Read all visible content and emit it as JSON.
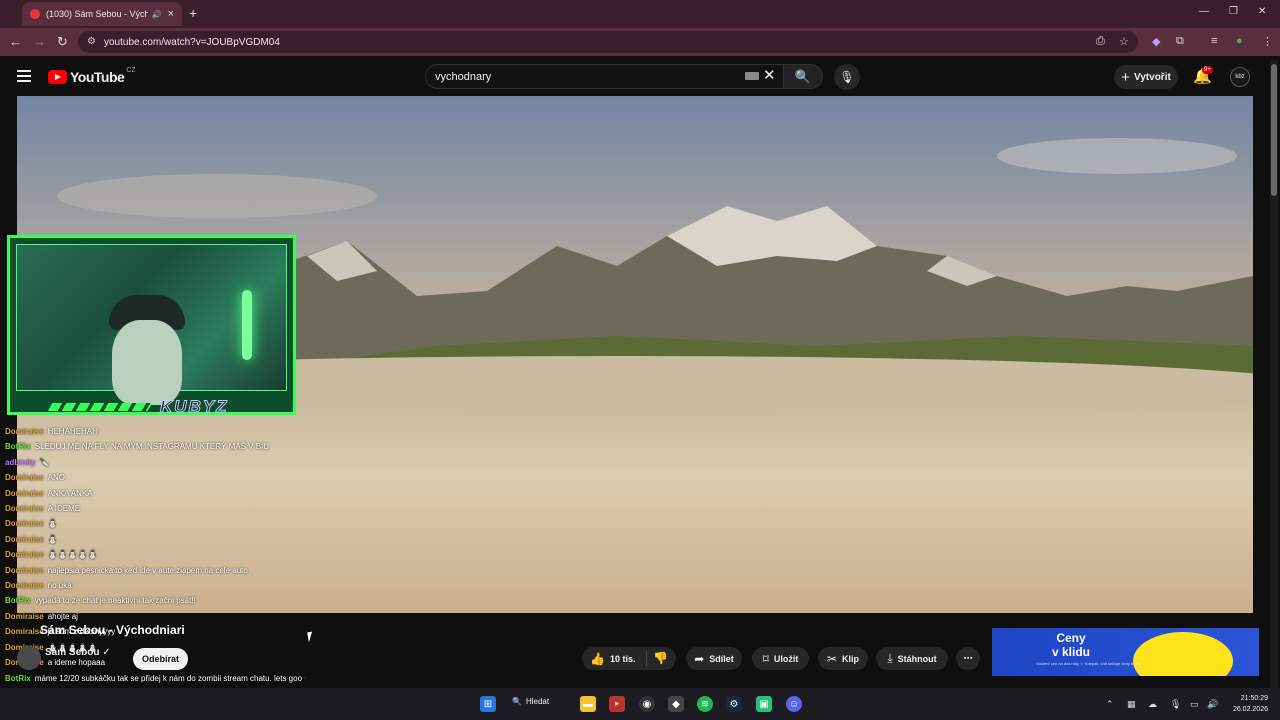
{
  "browser": {
    "tab_title": "(1030) Sám Sebou - Výcho",
    "new_tab": "+",
    "url": "youtube.com/watch?v=JOUBpVGDM04",
    "minimize": "—",
    "maximize": "❐",
    "close": "✕"
  },
  "masthead": {
    "logo_text": "YouTube",
    "country": "CZ",
    "search_value": "vychodnary",
    "create_label": "Vytvořit",
    "notifications_badge": "9+",
    "avatar_text": "kbz"
  },
  "overlay": {
    "brand": "KUBYZ"
  },
  "chat": [
    {
      "user": "Domiraise",
      "text": "HEHAHEHAH",
      "color": "#d9a53a"
    },
    {
      "user": "BotRix",
      "text": "SLEDUJ MĚ NA FLY NA MÝM INSTAGRAMU KTERÝ MÁŠ V BIU",
      "color": "#6bdc3c"
    },
    {
      "user": "adbinity",
      "text": "🔪",
      "color": "#b57bff"
    },
    {
      "user": "Domiraise",
      "text": "ANO",
      "color": "#d9a53a"
    },
    {
      "user": "Domiraise",
      "text": "ANKA ANKA",
      "color": "#d9a53a"
    },
    {
      "user": "Domiraise",
      "text": "A IDEME",
      "color": "#d9a53a"
    },
    {
      "user": "Domiraise",
      "text": "⛄",
      "color": "#d9a53a"
    },
    {
      "user": "Domiraise",
      "text": "⛄",
      "color": "#d9a53a"
    },
    {
      "user": "Domiraise",
      "text": "⛄⛄⛄⛄⛄",
      "color": "#d9a53a"
    },
    {
      "user": "Domiraise",
      "text": "najlepsia pesnicka to ked ide v aute ziapem na cele auto",
      "color": "#d9a53a"
    },
    {
      "user": "Domiraise",
      "text": "no uka",
      "color": "#d9a53a"
    },
    {
      "user": "BotRix",
      "text": "vypadá to ze chat je neaktivní tak začni psát!!",
      "color": "#6bdc3c"
    },
    {
      "user": "Domiraise",
      "text": "ahojte aj",
      "color": "#d9a53a"
    },
    {
      "user": "Domiraise",
      "text": "ja som z dedinyyyy",
      "color": "#d9a53a"
    },
    {
      "user": "Domiraise",
      "text": "⛄⛄⛄⛄⛄",
      "color": "#d9a53a"
    },
    {
      "user": "Domiraise",
      "text": "a ideme hopaaa",
      "color": "#d9a53a"
    },
    {
      "user": "BotRix",
      "text": "máme 12/20 subkáčku tak se přidej k nám do zombii stream chatu. lets goo 😊",
      "color": "#6bdc3c"
    }
  ],
  "video": {
    "title": "Sám Sebou - Východniari",
    "channel": "Sám Sebou",
    "channel_suffix": "✓",
    "subscribe_label": "Odebírat",
    "likes": "10 tis.",
    "share_label": "Sdílet",
    "save_label": "Uložit",
    "clip_label": "Klip",
    "download_label": "Stáhnout",
    "more_label": "⋯"
  },
  "ad": {
    "headline": "Ceny\nv klidu",
    "subtext": "Snížení cen na dva roky ☆ Kdepak, Lidl snižuje ceny trvale."
  },
  "taskbar": {
    "search_label": "Hledat",
    "time": "21:50:29",
    "date": "26.02.2026"
  }
}
